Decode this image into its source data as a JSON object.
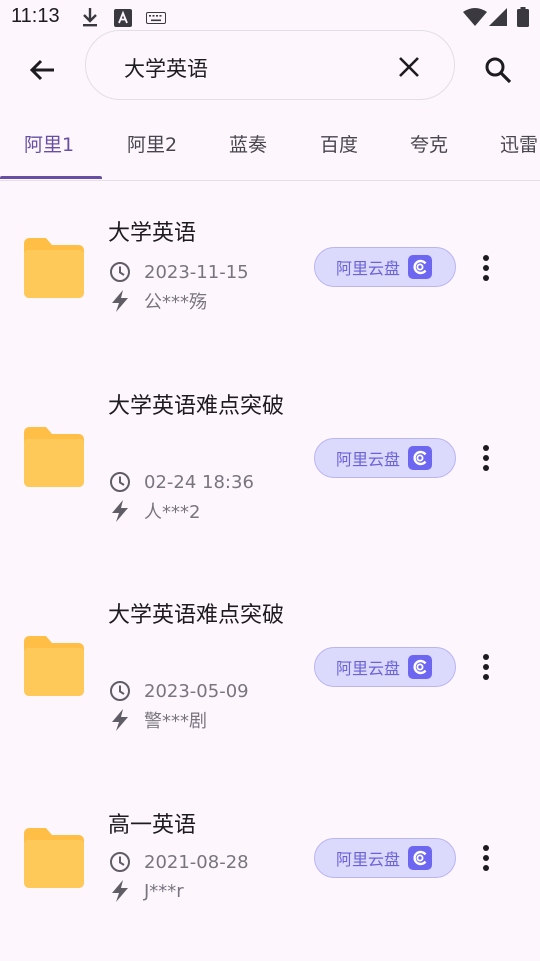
{
  "status_bar": {
    "time": "11:13"
  },
  "search": {
    "query": "大学英语"
  },
  "tabs": [
    {
      "label": "阿里1",
      "active": true
    },
    {
      "label": "阿里2",
      "active": false
    },
    {
      "label": "蓝奏",
      "active": false
    },
    {
      "label": "百度",
      "active": false
    },
    {
      "label": "夸克",
      "active": false
    },
    {
      "label": "迅雷",
      "active": false
    }
  ],
  "results": [
    {
      "title": "大学英语",
      "date": "2023-11-15",
      "author": "公***殇",
      "source": "阿里云盘"
    },
    {
      "title": "大学英语难点突破",
      "date": "02-24 18:36",
      "author": "人***2",
      "source": "阿里云盘"
    },
    {
      "title": "大学英语难点突破",
      "date": "2023-05-09",
      "author": "警***剧",
      "source": "阿里云盘"
    },
    {
      "title": "高一英语",
      "date": "2021-08-28",
      "author": "J***r",
      "source": "阿里云盘"
    }
  ],
  "colors": {
    "accent": "#6750a4",
    "chip_bg": "#dcdafc",
    "chip_text": "#6a63d8",
    "folder": "#ffc34f"
  }
}
